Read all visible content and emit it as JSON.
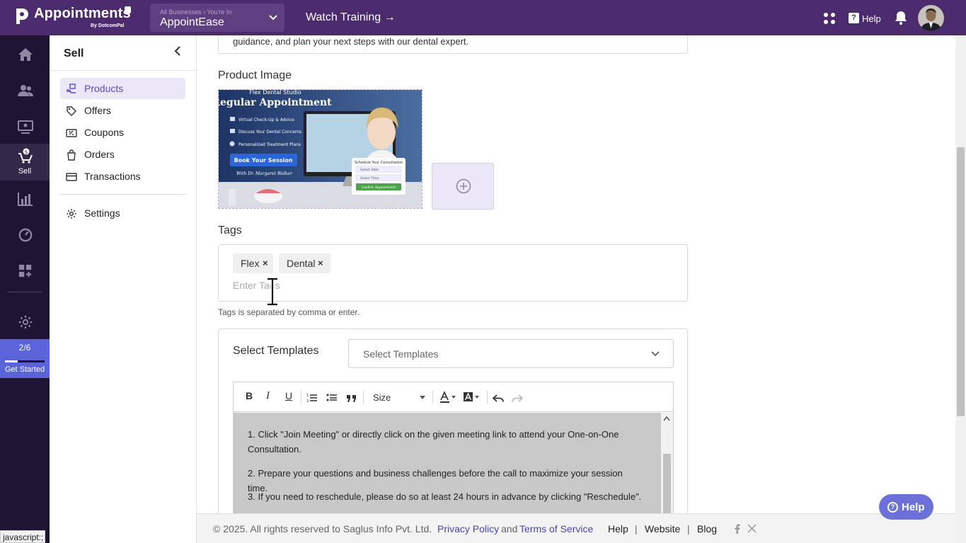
{
  "app": {
    "title": "Appointments",
    "byline": "By DotcomPal",
    "business_caption": "All Businesses › You're In",
    "business_name": "AppointEase",
    "watch_training": "Watch Training →",
    "help_label": "Help"
  },
  "rail": {
    "active_label": "Sell",
    "progress_text": "2/6",
    "progress_value": 0.33,
    "get_started": "Get Started"
  },
  "subnav": {
    "heading": "Sell",
    "items": [
      {
        "label": "Products"
      },
      {
        "label": "Offers"
      },
      {
        "label": "Coupons"
      },
      {
        "label": "Orders"
      },
      {
        "label": "Transactions"
      },
      {
        "label": "Settings"
      }
    ]
  },
  "main": {
    "description_snippet": "guidance, and plan your next steps with our dental expert.",
    "product_image_label": "Product Image",
    "image": {
      "studio": "Flex Dental Studio",
      "headline": "Regular Appointment",
      "bullets": [
        "Virtual Check-Up & Advice",
        "Discuss Your Dental Concerns",
        "Personalized Treatment Plans"
      ],
      "cta": "Book Your Session",
      "with": "With Dr. Margaret Walker",
      "card_title": "Schedule Your Consultation",
      "card_date": "Select Date",
      "card_time": "Select Time",
      "card_confirm": "Confirm Appointment"
    },
    "tags_label": "Tags",
    "tags": [
      "Flex",
      "Dental"
    ],
    "tag_remove": "×",
    "tags_placeholder": "Enter Tags",
    "tags_hint": "Tags is separated by comma or enter.",
    "templates_label": "Select Templates",
    "templates_placeholder": "Select Templates",
    "toolbar": {
      "bold": "B",
      "italic": "I",
      "underline": "U",
      "size": "Size"
    },
    "editor_lines": [
      "1. Click \"Join Meeting\" or directly click on the given meeting link to attend your One-on-One Consultation.",
      "2. Prepare your questions and business challenges before the call to maximize your session time.",
      "3. If you need to reschedule, please do so at least 24 hours in advance by clicking \"Reschedule\"."
    ]
  },
  "footer": {
    "copyright": "©  2025. All rights reserved to Saglus Info Pvt. Ltd.",
    "privacy": "Privacy Policy",
    "and": "and",
    "terms": "Terms of Service",
    "help": "Help",
    "sep": "|",
    "website": "Website",
    "blog": "Blog"
  },
  "help_fab": "Help",
  "status_bar": "javascript:;",
  "colors": {
    "topbar": "#4b2a6d",
    "rail": "#1f1433",
    "accent": "#5b49c9",
    "get_started": "#5a63d8"
  }
}
